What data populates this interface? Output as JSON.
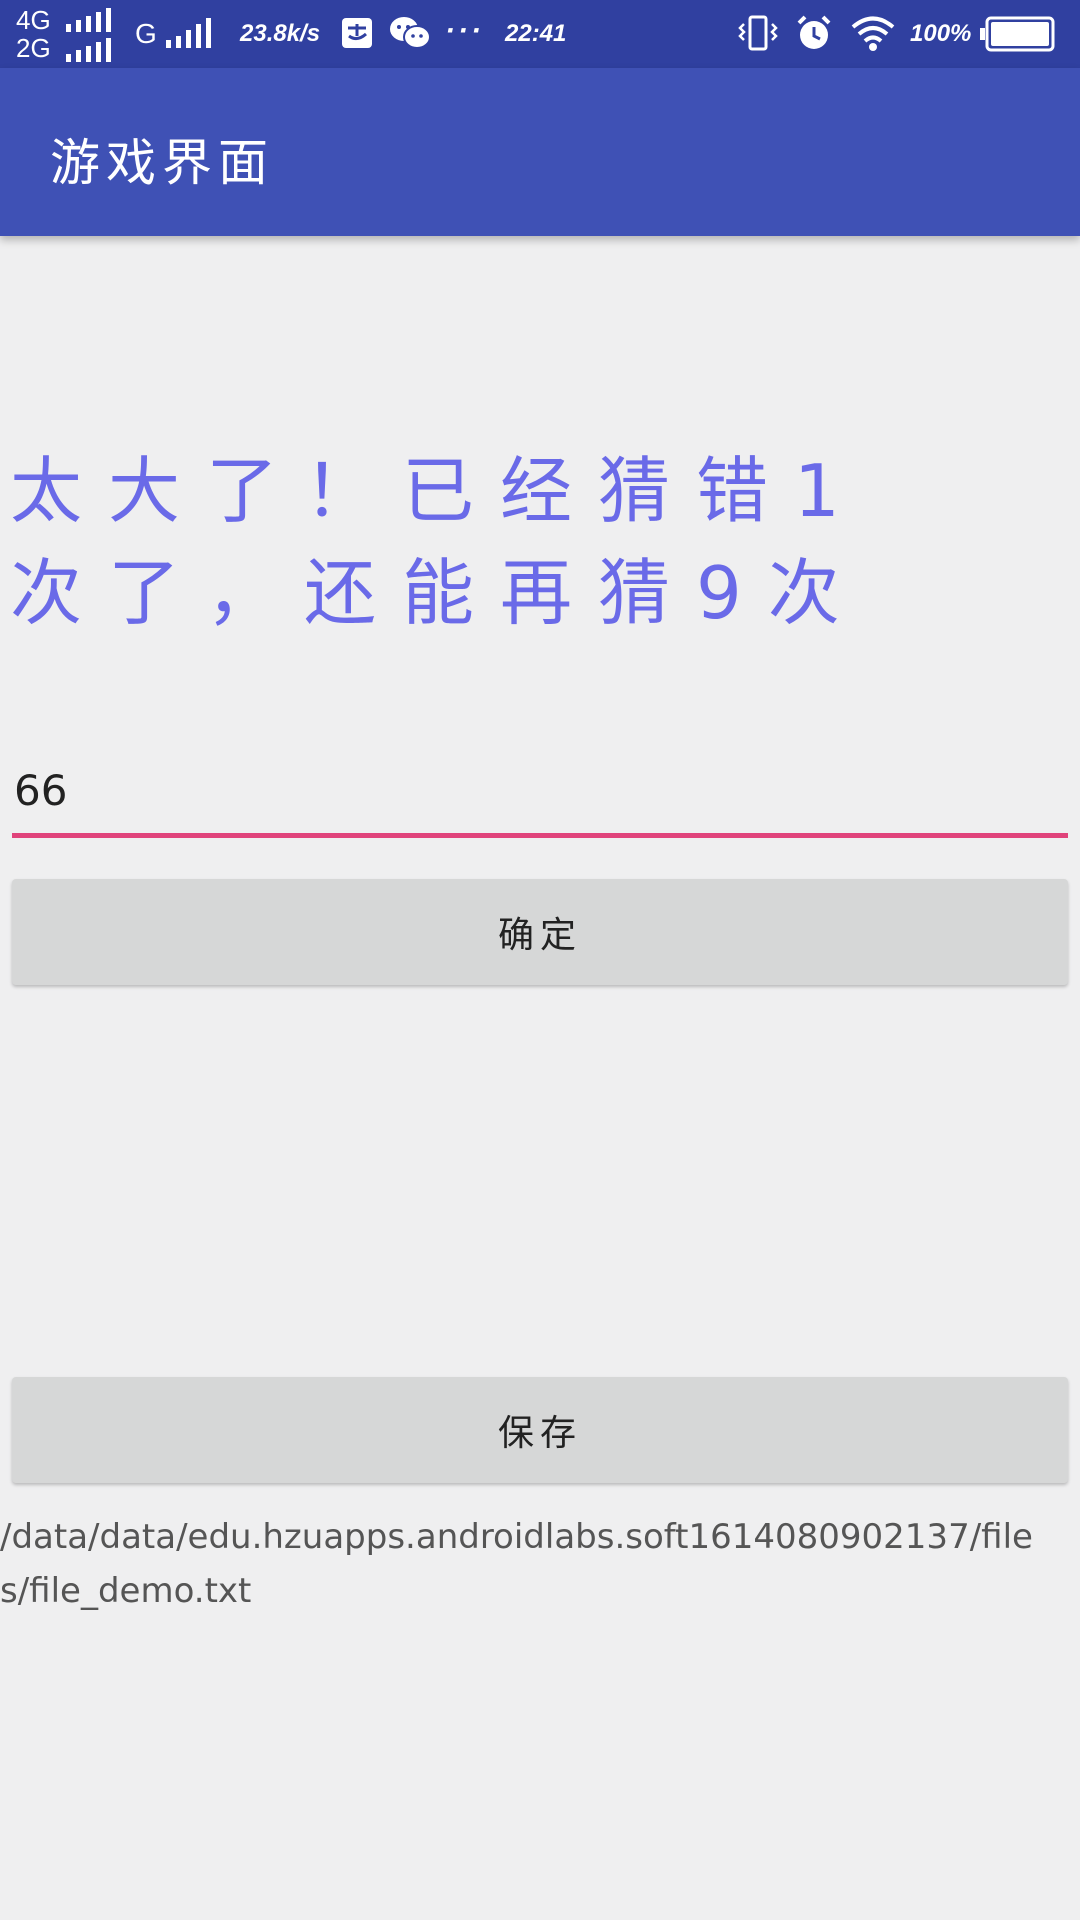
{
  "status_bar": {
    "network_top": "4G",
    "network_bottom": "2G",
    "network_mid": "G",
    "speed": "23.8k/s",
    "more": "···",
    "time": "22:41",
    "battery_percent": "100",
    "color": "#3040a0"
  },
  "app_bar": {
    "title": "游戏界面",
    "color": "#3f51b5"
  },
  "main": {
    "message": "太大了！已经猜错1次了，还能再猜9次",
    "message_color": "#6a6ae8",
    "input_value": "66",
    "input_underline_color": "#e0437b",
    "confirm_label": "确定",
    "save_label": "保存",
    "file_path": "/data/data/edu.hzuapps.androidlabs.soft1614080902137/files/file_demo.txt"
  }
}
